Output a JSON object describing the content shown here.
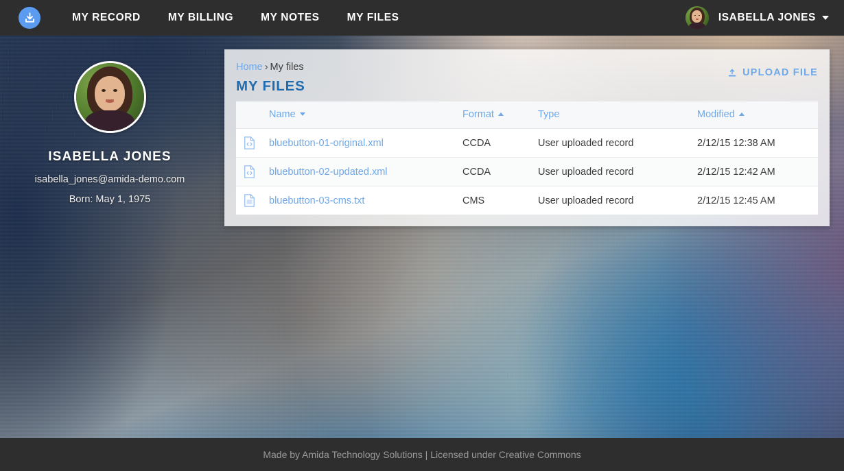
{
  "navbar": {
    "logo_icon": "download-circle-icon",
    "links": [
      {
        "label": "MY RECORD"
      },
      {
        "label": "MY BILLING"
      },
      {
        "label": "MY NOTES"
      },
      {
        "label": "MY FILES"
      }
    ],
    "user": {
      "name": "ISABELLA JONES",
      "avatar_icon": "user-avatar",
      "caret_icon": "chevron-down-icon"
    }
  },
  "profile": {
    "avatar_icon": "profile-photo",
    "name": "ISABELLA JONES",
    "email": "isabella_jones@amida-demo.com",
    "born": "Born: May 1, 1975"
  },
  "panel": {
    "breadcrumb": {
      "home": "Home",
      "separator": "›",
      "current": "My files"
    },
    "title": "MY FILES",
    "upload_button": {
      "label": "UPLOAD FILE",
      "icon": "upload-icon"
    },
    "table": {
      "columns": [
        {
          "key": "icon",
          "label": "",
          "sort": "none"
        },
        {
          "key": "name",
          "label": "Name",
          "sort": "desc"
        },
        {
          "key": "format",
          "label": "Format",
          "sort": "asc"
        },
        {
          "key": "type",
          "label": "Type",
          "sort": "none"
        },
        {
          "key": "mod",
          "label": "Modified",
          "sort": "asc"
        }
      ],
      "rows": [
        {
          "icon": "file-code-icon",
          "name": "bluebutton-01-original.xml",
          "format": "CCDA",
          "type": "User uploaded record",
          "modified": "2/12/15 12:38 AM"
        },
        {
          "icon": "file-code-icon",
          "name": "bluebutton-02-updated.xml",
          "format": "CCDA",
          "type": "User uploaded record",
          "modified": "2/12/15 12:42 AM"
        },
        {
          "icon": "file-text-icon",
          "name": "bluebutton-03-cms.txt",
          "format": "CMS",
          "type": "User uploaded record",
          "modified": "2/12/15 12:45 AM"
        }
      ]
    }
  },
  "footer": {
    "text": "Made by Amida Technology Solutions | Licensed under Creative Commons"
  },
  "colors": {
    "navbar_bg": "#2e2e2e",
    "footer_bg": "#2e2e2e",
    "accent_blue": "#6ea8e8",
    "title_blue": "#1f6cb0",
    "logo_blue": "#5b9bf0",
    "panel_bg": "rgba(255,255,255,0.80)",
    "table_bg": "#ffffff"
  }
}
